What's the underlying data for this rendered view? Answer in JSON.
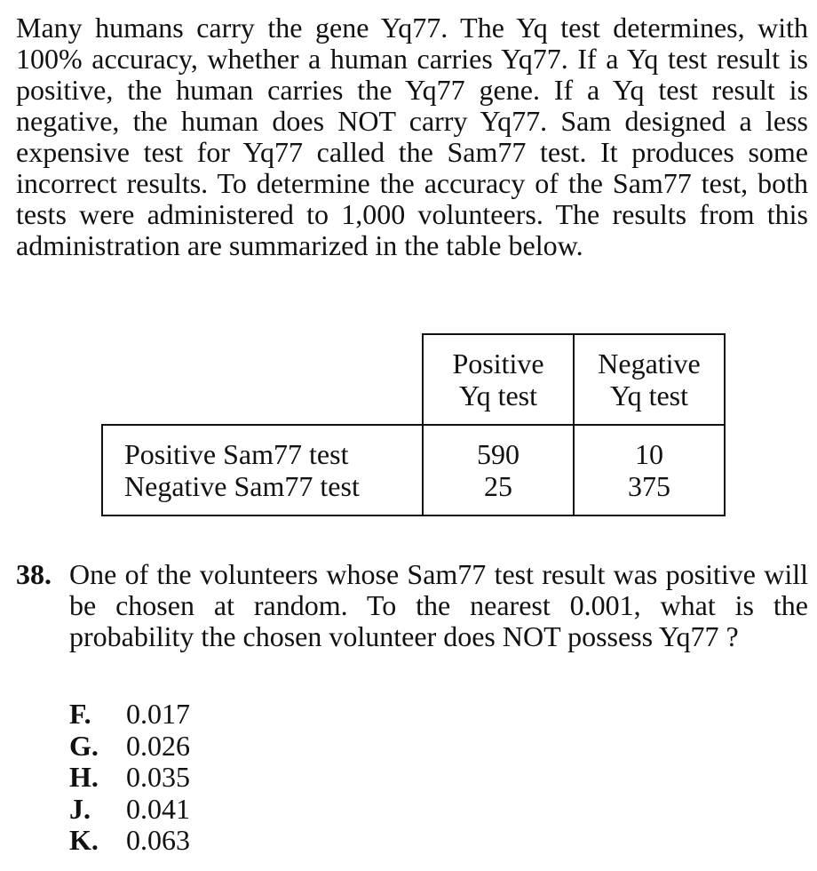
{
  "passage": "Many humans carry the gene Yq77. The Yq test determines, with 100% accuracy, whether a human carries Yq77. If a Yq test result is positive, the human carries the Yq77 gene. If a Yq test result is negative, the human does NOT carry Yq77. Sam designed a less expensive test for Yq77 called the Sam77 test. It produces some incorrect results. To determine the accuracy of the Sam77 test, both tests were administered to 1,000 volunteers. The results from this administration are summarized in the table below.",
  "table": {
    "columns": [
      {
        "line1": "Positive",
        "line2": "Yq test"
      },
      {
        "line1": "Negative",
        "line2": "Yq test"
      }
    ],
    "rows": [
      {
        "label": "Positive Sam77 test",
        "values": [
          "590",
          "10"
        ]
      },
      {
        "label": "Negative Sam77 test",
        "values": [
          "25",
          "375"
        ]
      }
    ]
  },
  "question": {
    "number": "38.",
    "text": "One of the volunteers whose Sam77 test result was positive will be chosen at random. To the nearest 0.001, what is the probability the chosen volunteer does NOT possess Yq77 ?",
    "choices": [
      {
        "letter": "F.",
        "value": "0.017"
      },
      {
        "letter": "G.",
        "value": "0.026"
      },
      {
        "letter": "H.",
        "value": "0.035"
      },
      {
        "letter": "J.",
        "value": "0.041"
      },
      {
        "letter": "K.",
        "value": "0.063"
      }
    ]
  }
}
